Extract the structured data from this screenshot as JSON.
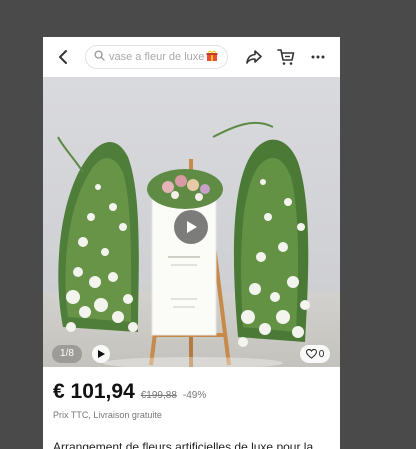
{
  "header": {
    "search_placeholder": "vase a fleur de luxe",
    "icons": [
      "back-arrow-icon",
      "search-icon",
      "gift-icon",
      "share-icon",
      "cart-icon",
      "more-icon"
    ]
  },
  "gallery": {
    "counter": "1/8",
    "likes": "0"
  },
  "product": {
    "price": "€ 101,94",
    "original_price": "€199,88",
    "discount": "-49%",
    "tax_info": "Prix TTC, Livraison gratuite",
    "title": "Arrangement de fleurs artificielles de luxe pour la"
  }
}
